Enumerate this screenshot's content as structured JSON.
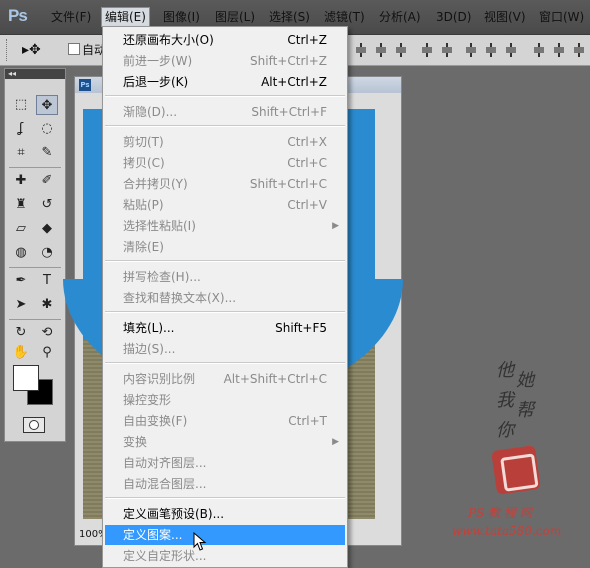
{
  "app": {
    "logo": "Ps"
  },
  "menubar": {
    "items": [
      "文件(F)",
      "编辑(E)",
      "图像(I)",
      "图层(L)",
      "选择(S)",
      "滤镜(T)",
      "分析(A)",
      "3D(D)",
      "视图(V)",
      "窗口(W)"
    ],
    "active": "编辑(E)"
  },
  "options": {
    "auto_label": "自动"
  },
  "document": {
    "zoom": "100%"
  },
  "edit_menu": {
    "items": [
      {
        "label": "还原画布大小(O)",
        "shortcut": "Ctrl+Z",
        "state": "enabled"
      },
      {
        "label": "前进一步(W)",
        "shortcut": "Shift+Ctrl+Z",
        "state": "disabled"
      },
      {
        "label": "后退一步(K)",
        "shortcut": "Alt+Ctrl+Z",
        "state": "enabled"
      },
      {
        "label": "渐隐(D)...",
        "shortcut": "Shift+Ctrl+F",
        "state": "disabled"
      },
      {
        "label": "剪切(T)",
        "shortcut": "Ctrl+X",
        "state": "disabled"
      },
      {
        "label": "拷贝(C)",
        "shortcut": "Ctrl+C",
        "state": "disabled"
      },
      {
        "label": "合并拷贝(Y)",
        "shortcut": "Shift+Ctrl+C",
        "state": "disabled"
      },
      {
        "label": "粘贴(P)",
        "shortcut": "Ctrl+V",
        "state": "disabled"
      },
      {
        "label": "选择性粘贴(I)",
        "shortcut": "",
        "state": "disabled",
        "submenu": true
      },
      {
        "label": "清除(E)",
        "shortcut": "",
        "state": "disabled"
      },
      {
        "label": "拼写检查(H)...",
        "shortcut": "",
        "state": "disabled"
      },
      {
        "label": "查找和替换文本(X)...",
        "shortcut": "",
        "state": "disabled"
      },
      {
        "label": "填充(L)...",
        "shortcut": "Shift+F5",
        "state": "enabled"
      },
      {
        "label": "描边(S)...",
        "shortcut": "",
        "state": "disabled"
      },
      {
        "label": "内容识别比例",
        "shortcut": "Alt+Shift+Ctrl+C",
        "state": "disabled"
      },
      {
        "label": "操控变形",
        "shortcut": "",
        "state": "disabled"
      },
      {
        "label": "自由变换(F)",
        "shortcut": "Ctrl+T",
        "state": "disabled"
      },
      {
        "label": "变换",
        "shortcut": "",
        "state": "disabled",
        "submenu": true
      },
      {
        "label": "自动对齐图层...",
        "shortcut": "",
        "state": "disabled"
      },
      {
        "label": "自动混合图层...",
        "shortcut": "",
        "state": "disabled"
      },
      {
        "label": "定义画笔预设(B)...",
        "shortcut": "",
        "state": "enabled"
      },
      {
        "label": "定义图案...",
        "shortcut": "",
        "state": "highlighted"
      },
      {
        "label": "定义自定形状...",
        "shortcut": "",
        "state": "disabled"
      }
    ]
  },
  "watermark": {
    "calligraphy": [
      "他",
      "她",
      "我",
      "帮",
      "你"
    ],
    "url": "PS 教 程 网",
    "site": "www.tata580.com"
  },
  "colors": {
    "highlight": "#3399ff",
    "sky": "#2a8bd0",
    "seal": "#b9403a"
  }
}
